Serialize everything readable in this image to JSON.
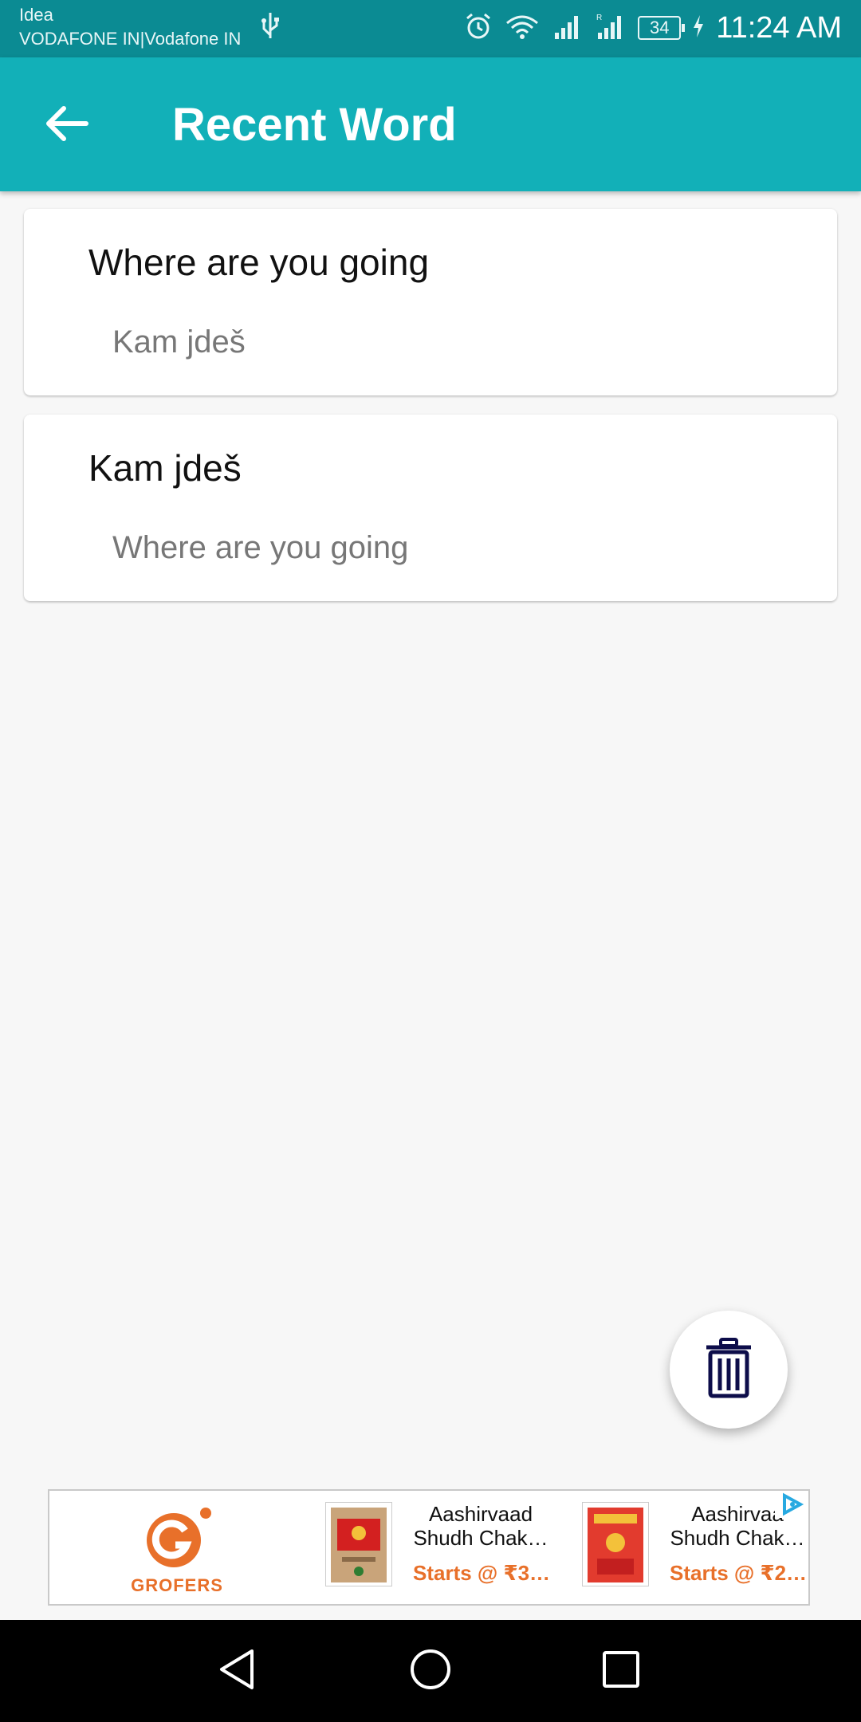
{
  "status_bar": {
    "carrier_line1": "Idea",
    "carrier_line2": "VODAFONE IN|Vodafone IN",
    "battery": "34",
    "time": "11:24 AM",
    "icons": [
      "usb-icon",
      "alarm-icon",
      "wifi-icon",
      "signal-icon",
      "signal-roaming-icon",
      "battery-icon",
      "charging-icon"
    ]
  },
  "app_bar": {
    "title": "Recent Word",
    "back_icon": "arrow-back-icon",
    "color": "#12b0b8"
  },
  "recent_words": [
    {
      "word": "Where are you going",
      "translation": "Kam jdeš"
    },
    {
      "word": "Kam jdeš",
      "translation": "Where are you going"
    }
  ],
  "fab": {
    "icon": "trash-icon",
    "icon_color": "#0d0d4a"
  },
  "ad": {
    "brand": "GROFERS",
    "brand_color": "#e8702a",
    "products": [
      {
        "name_line1": "Aashirvaad",
        "name_line2": "Shudh Chak…",
        "price": "Starts @ ₹3…"
      },
      {
        "name_line1": "Aashirvaa",
        "name_line2": "Shudh Chak…",
        "price": "Starts @ ₹2…"
      }
    ],
    "choices_icon": "ad-choices-icon"
  },
  "nav_bar": {
    "icons": [
      "nav-back-icon",
      "nav-home-icon",
      "nav-recents-icon"
    ]
  }
}
